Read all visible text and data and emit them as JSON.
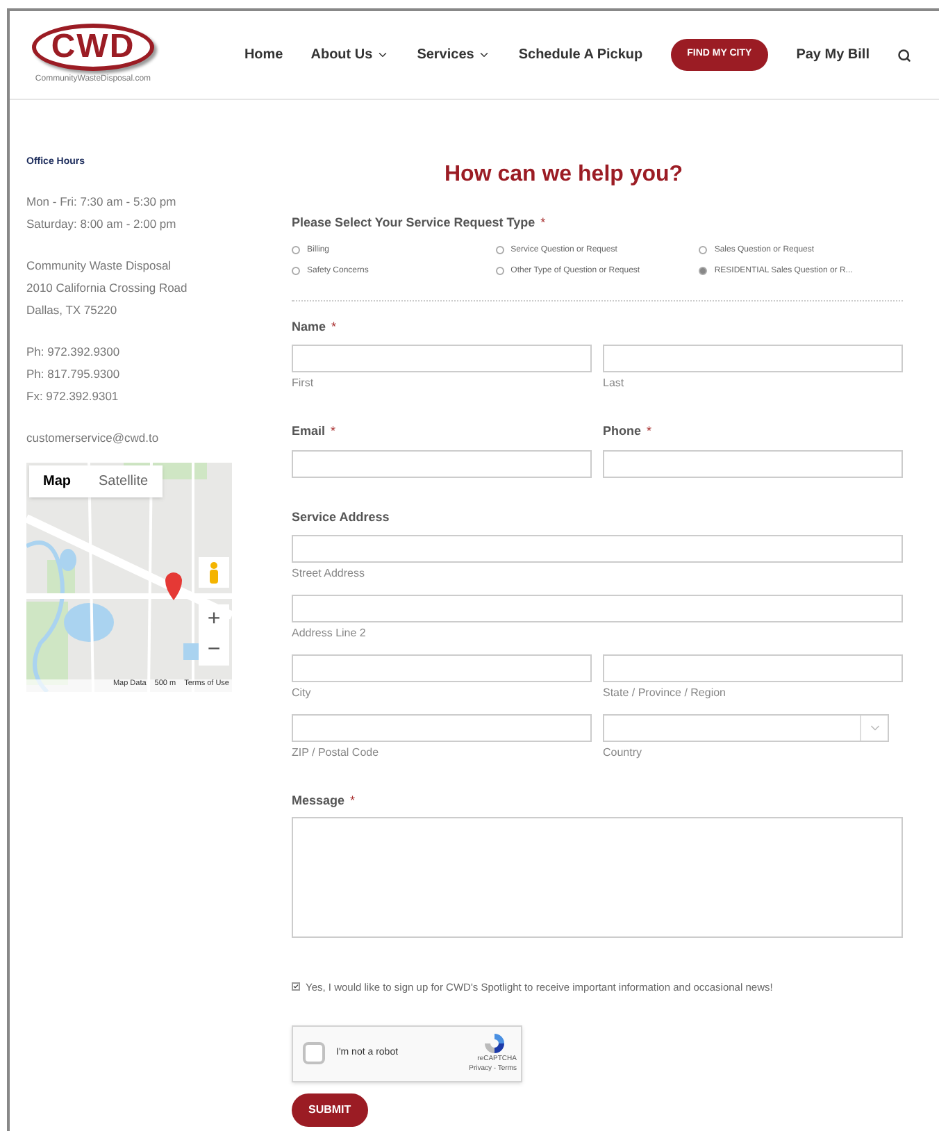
{
  "header": {
    "logo": {
      "text": "CWD",
      "tagline": "CommunityWasteDisposal.com"
    },
    "nav": [
      {
        "label": "Home",
        "kind": "link"
      },
      {
        "label": "About Us",
        "kind": "dropdown"
      },
      {
        "label": "Services",
        "kind": "dropdown"
      },
      {
        "label": "Schedule A Pickup",
        "kind": "link"
      },
      {
        "label": "FIND MY CITY",
        "kind": "button"
      },
      {
        "label": "Pay My Bill",
        "kind": "link"
      },
      {
        "kind": "search"
      }
    ]
  },
  "sidebar": {
    "heading": "Office Hours",
    "groups": [
      [
        "Mon - Fri: 7:30 am - 5:30 pm",
        "Saturday: 8:00 am - 2:00 pm"
      ],
      [
        "Community Waste Disposal",
        "2010 California Crossing Road",
        "Dallas, TX 75220"
      ],
      [
        "Ph: 972.392.9300",
        "Ph: 817.795.9300",
        "Fx: 972.392.9301"
      ],
      [
        "customerservice@cwd.to"
      ]
    ],
    "map": {
      "map_types": [
        {
          "label": "Map",
          "selected": true
        },
        {
          "label": "Satellite",
          "selected": false
        }
      ],
      "zoom": [
        "+",
        "−"
      ],
      "footer": [
        "Map Data",
        "500 m",
        "Terms of Use"
      ]
    }
  },
  "form": {
    "title": "How can we help you?",
    "request_type": {
      "label": "Please Select Your Service Request Type",
      "mark": "*",
      "options": [
        {
          "label": "Billing",
          "selected": false
        },
        {
          "label": "Service Question or Request",
          "selected": false
        },
        {
          "label": "Sales Question or Request",
          "selected": false
        },
        {
          "label": "Safety Concerns",
          "selected": false
        },
        {
          "label": "Other Type of Question or Request",
          "selected": false
        },
        {
          "label": "RESIDENTIAL Sales Question or R...",
          "selected": true
        }
      ]
    },
    "name": {
      "label": "Name",
      "mark": "*",
      "fields": [
        "First",
        "Last"
      ]
    },
    "contact": [
      {
        "label": "Email",
        "mark": "*"
      },
      {
        "label": "Phone",
        "mark": "*"
      }
    ],
    "address": {
      "label": "Service Address",
      "rows": [
        [
          {
            "sub": "Street Address",
            "kind": "text"
          }
        ],
        [
          {
            "sub": "Address Line 2",
            "kind": "text"
          }
        ],
        [
          {
            "sub": "City",
            "kind": "text"
          },
          {
            "sub": "State / Province / Region",
            "kind": "text"
          }
        ],
        [
          {
            "sub": "ZIP / Postal Code",
            "kind": "text"
          },
          {
            "sub": "Country",
            "kind": "select"
          }
        ]
      ]
    },
    "message": {
      "label": "Message",
      "mark": "*"
    },
    "newsletter": {
      "label": "Yes, I would like to sign up for CWD's Spotlight to receive important information and occasional news!",
      "checked": true
    },
    "captcha": {
      "label": "I'm not a robot",
      "checked": false,
      "brand": "reCAPTCHA",
      "links": "Privacy - Terms"
    },
    "submit": "SUBMIT"
  }
}
